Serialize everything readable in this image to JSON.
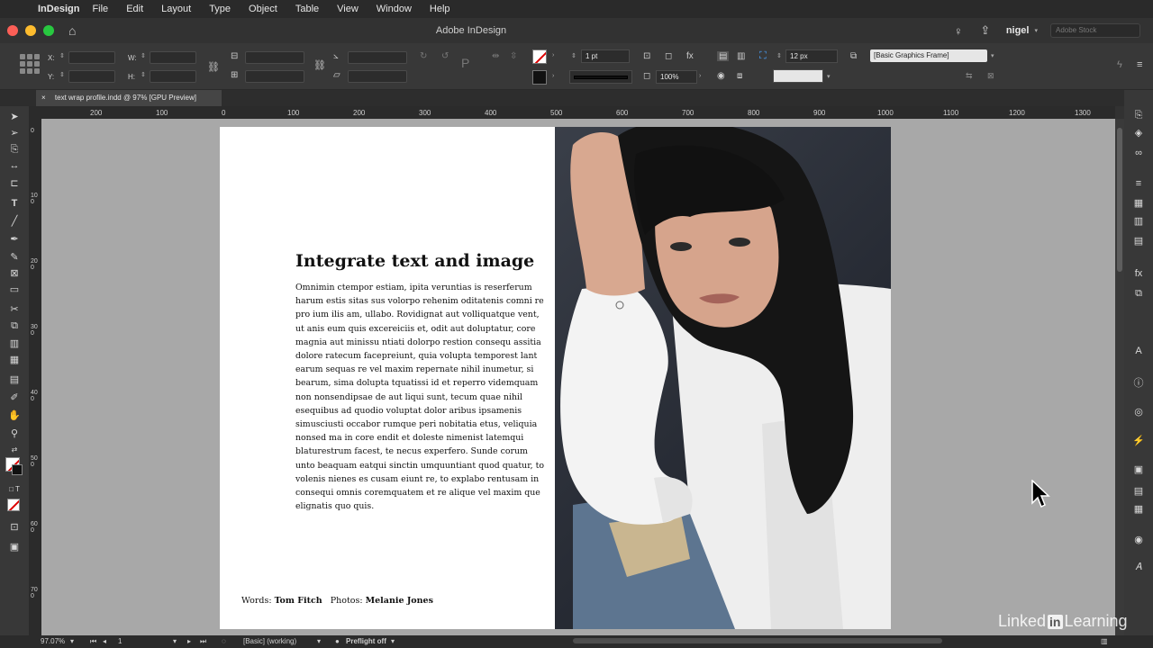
{
  "menubar": {
    "app": "InDesign",
    "items": [
      "File",
      "Edit",
      "Layout",
      "Type",
      "Object",
      "Table",
      "View",
      "Window",
      "Help"
    ]
  },
  "titlebar": {
    "title": "Adobe InDesign",
    "user": "nigel",
    "stock_placeholder": "Adobe Stock"
  },
  "control": {
    "x_label": "X:",
    "y_label": "Y:",
    "w_label": "W:",
    "h_label": "H:",
    "stroke_weight": "1 pt",
    "opacity": "100%",
    "corner_size": "12 px",
    "object_style": "[Basic Graphics Frame]"
  },
  "document": {
    "tab_title": "text wrap profile.indd @ 97% [GPU Preview]",
    "close_glyph": "×"
  },
  "ruler": {
    "h_ticks": [
      "200",
      "100",
      "0",
      "100",
      "200",
      "300",
      "400",
      "500",
      "600",
      "700",
      "800",
      "900",
      "1000",
      "1100",
      "1200",
      "1300"
    ],
    "v_ticks": [
      "0",
      "100",
      "200",
      "300",
      "400",
      "500",
      "600",
      "700"
    ]
  },
  "page": {
    "headline": "Integrate text and image",
    "body_lines": [
      "Omnimin ctempor estiam, ipita veruntias is reserferum",
      "harum estis sitas sus volorpo rehenim oditatenis comni re",
      "pro ium ilis am, ullabo. Rovidignat aut volliquatque vent,",
      "ut anis eum quis excereiciis et, odit aut doluptatur, core",
      "magnia aut minissu ntiati dolorpo restion consequ assitia",
      "dolore ratecum facepreiunt, quia volupta temporest lant",
      "earum sequas re vel maxim repernate nihil inumetur, si",
      "bearum, sima dolupta tquatissi id et reperro videmquam",
      "non nonsendipsae de aut liqui sunt, tecum quae nihil",
      "esequibus ad quodio voluptat dolor aribus ipsamenis",
      "simusciusti occabor rumque peri nobitatia etus, veliquia",
      "nonsed ma in core endit et doleste nimenist latemqui",
      "blaturestrum facest, te necus experfero. Sunde corum",
      "unto beaquam eatqui sinctin umquuntiant quod quatur, to",
      "volenis nienes es cusam eiunt re, to explabo rentusam in",
      "consequi omnis coremquatem et re alique vel maxim que",
      "elignatis quo quis."
    ],
    "credits_words_label": "Words:",
    "credits_words_name": "Tom Fitch",
    "credits_photos_label": "Photos:",
    "credits_photos_name": "Melanie Jones"
  },
  "status": {
    "zoom": "97.07%",
    "page": "1",
    "profile": "[Basic] (working)",
    "preflight": "Preflight off"
  },
  "watermark": {
    "pre": "Linked",
    "in": "in",
    "post": "Learning"
  },
  "colors": {
    "accent": "#fc5f57",
    "pasteboard": "#a8a8a8",
    "ui_dark": "#323232"
  }
}
